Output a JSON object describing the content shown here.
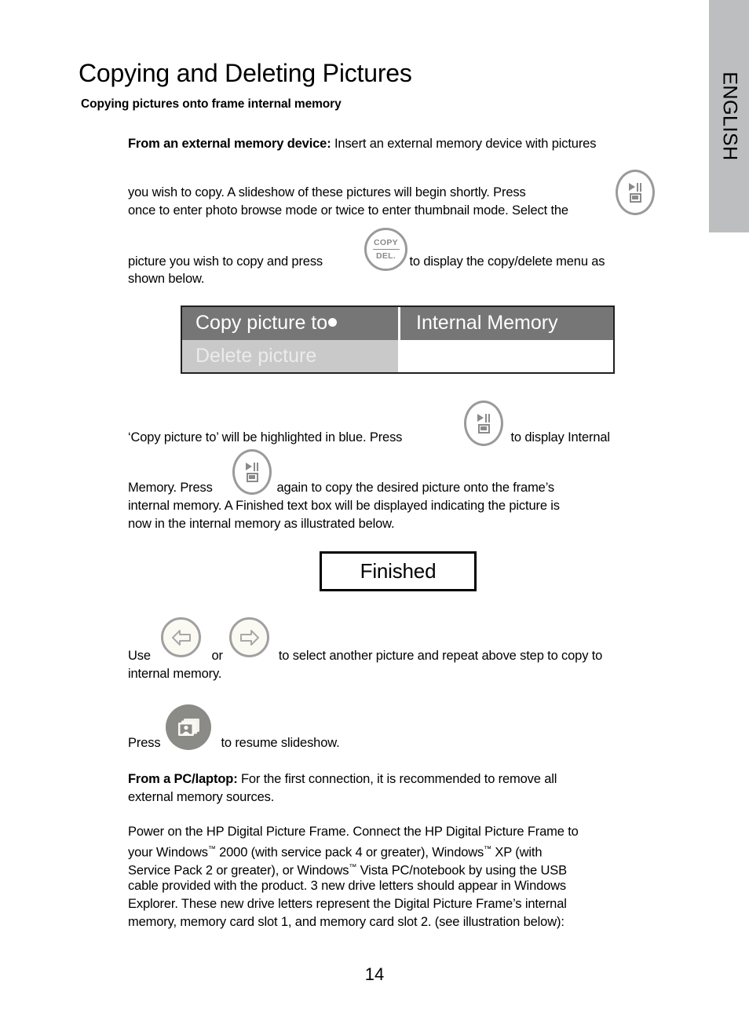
{
  "language_tab": {
    "label": "ENGLISH",
    "background": "#bcbec0"
  },
  "page": {
    "title": "Copying and Deleting Pictures",
    "section_heading": "Copying pictures onto frame internal memory",
    "page_number": "14"
  },
  "paragraphs": {
    "external_device_lead": "From an external memory device:",
    "external_device_rest": " Insert an external memory device with pictures",
    "p1_a": "you wish to copy.  A slideshow of these pictures will begin shortly.  Press",
    "p1_b": "once to enter photo browse mode or twice to enter thumbnail mode.  Select the",
    "p2_a": "picture you wish to copy and press",
    "p2_b": "to display the copy/delete menu as",
    "p2_c": "shown below.",
    "p3_a": "‘Copy picture to’ will be highlighted in blue. Press",
    "p3_b": "to display Internal",
    "p4_a": "Memory. Press",
    "p4_b": "again to copy the desired picture onto the frame’s",
    "p4_c": "internal memory. A Finished text box will be displayed indicating the picture is",
    "p4_d": "now in the internal memory as illustrated below.",
    "p5_a": "Use",
    "p5_or": "or",
    "p5_b": "to select another picture and repeat above step to copy to",
    "p5_c": "internal memory.",
    "p6_a": "Press",
    "p6_b": "to resume slideshow.",
    "pc_lead": "From a PC/laptop:",
    "pc_rest": " For the first connection, it is recommended to remove all",
    "pc_line2": "external memory sources.",
    "final_1": "Power on the HP Digital Picture Frame.  Connect the HP Digital Picture Frame to",
    "final_2a": "your Windows",
    "final_2b": " 2000 (with service pack 4 or greater), Windows",
    "final_2c": " XP (with",
    "final_3a": "Service Pack 2 or greater), or Windows",
    "final_3b": " Vista PC/notebook by using the USB",
    "final_4": "cable provided with the product.  3 new drive letters should appear in Windows",
    "final_5": "Explorer. These new drive letters represent the Digital Picture Frame’s internal",
    "final_6": "memory, memory card slot 1, and memory card slot 2. (see illustration below):",
    "trademark": "™"
  },
  "menu_graphic": {
    "row1_left": "Copy picture to",
    "row1_right": "Internal Memory",
    "row2_left": "Delete picture",
    "row2_right": "",
    "selected_row_color": "#767676",
    "unselected_row_color": "#c9c9c9"
  },
  "finished_dialog": {
    "label": "Finished"
  },
  "buttons": {
    "slideshow_play_pause": "play-pause-frame-icon",
    "copy_delete_top": "COPY",
    "copy_delete_bottom": "DEL.",
    "left_arrow": "left-arrow-icon",
    "right_arrow": "right-arrow-icon",
    "photo_stack": "photo-stack-icon"
  }
}
